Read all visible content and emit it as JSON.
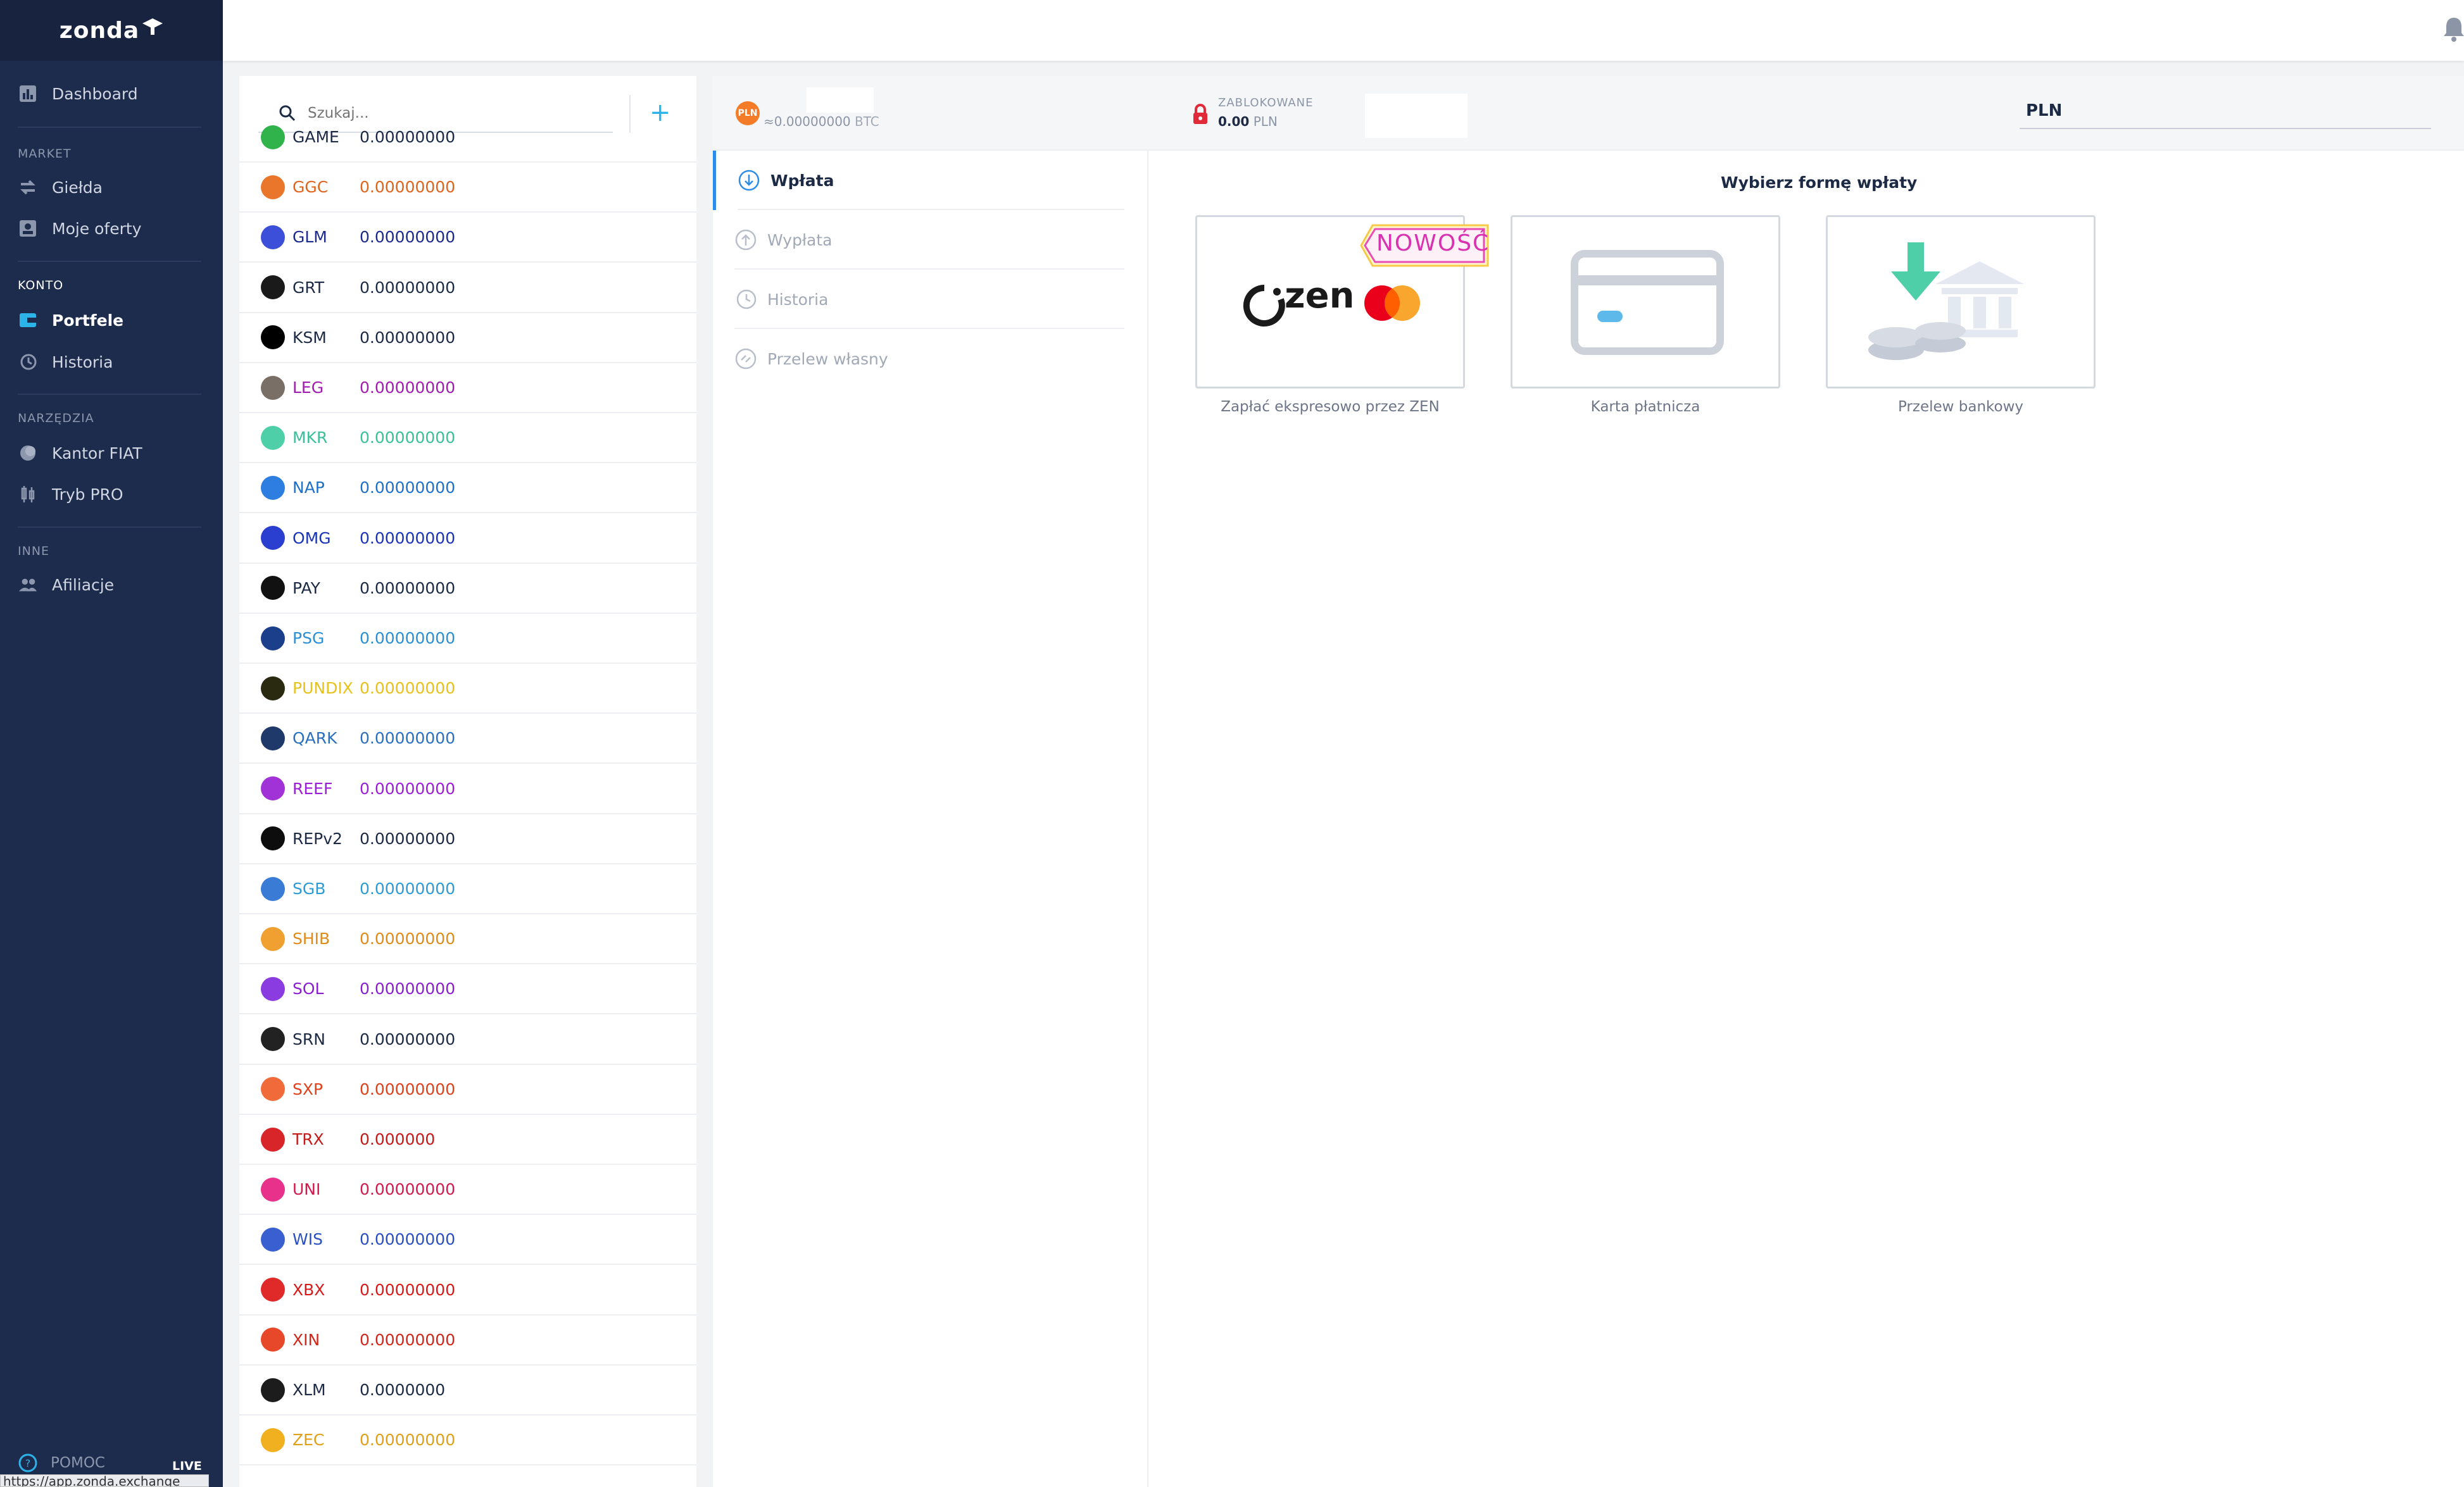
{
  "app": {
    "logo_text": "zonda"
  },
  "sidebar": {
    "dashboard": "Dashboard",
    "section_market": "MARKET",
    "gielda": "Giełda",
    "moje_oferty": "Moje oferty",
    "section_konto": "KONTO",
    "portfele": "Portfele",
    "historia": "Historia",
    "section_narzedzia": "NARZĘDZIA",
    "kantor": "Kantor FIAT",
    "tryb_pro": "Tryb PRO",
    "section_inne": "INNE",
    "afiliacje": "Afiliacje",
    "pomoc": "POMOC",
    "live": "LIVE",
    "status_url": "https://app.zonda.exchange"
  },
  "wallets": {
    "search_placeholder": "Szukaj...",
    "add": "+",
    "rows": [
      {
        "symbol": "GAME",
        "balance": "0.00000000",
        "color": "#1c2a45",
        "icon": "#2fb34a"
      },
      {
        "symbol": "GGC",
        "balance": "0.00000000",
        "color": "#e0641c",
        "icon": "#e9762a"
      },
      {
        "symbol": "GLM",
        "balance": "0.00000000",
        "color": "#1c2a8c",
        "icon": "#3c4fd8"
      },
      {
        "symbol": "GRT",
        "balance": "0.00000000",
        "color": "#1c2a45",
        "icon": "#1a1a1a"
      },
      {
        "symbol": "KSM",
        "balance": "0.00000000",
        "color": "#1c2a45",
        "icon": "#000000"
      },
      {
        "symbol": "LEG",
        "balance": "0.00000000",
        "color": "#a21caf",
        "icon": "#7a6f66"
      },
      {
        "symbol": "MKR",
        "balance": "0.00000000",
        "color": "#3bbf9a",
        "icon": "#4fcfa8"
      },
      {
        "symbol": "NAP",
        "balance": "0.00000000",
        "color": "#1f6fc9",
        "icon": "#2d7ee0"
      },
      {
        "symbol": "OMG",
        "balance": "0.00000000",
        "color": "#1a34b8",
        "icon": "#2a3fd0"
      },
      {
        "symbol": "PAY",
        "balance": "0.00000000",
        "color": "#1c2a45",
        "icon": "#111111"
      },
      {
        "symbol": "PSG",
        "balance": "0.00000000",
        "color": "#2b8fd6",
        "icon": "#1c3f8c"
      },
      {
        "symbol": "PUNDIX",
        "balance": "0.00000000",
        "color": "#e8c21a",
        "icon": "#2a2a10"
      },
      {
        "symbol": "QARK",
        "balance": "0.00000000",
        "color": "#2b6fbf",
        "icon": "#1f3a6a"
      },
      {
        "symbol": "REEF",
        "balance": "0.00000000",
        "color": "#9b1fd6",
        "icon": "#a032d8"
      },
      {
        "symbol": "REPv2",
        "balance": "0.00000000",
        "color": "#1c2a45",
        "icon": "#0d0d0d"
      },
      {
        "symbol": "SGB",
        "balance": "0.00000000",
        "color": "#2c9bd6",
        "icon": "#3a7bd6"
      },
      {
        "symbol": "SHIB",
        "balance": "0.00000000",
        "color": "#e08a1a",
        "icon": "#f0a030"
      },
      {
        "symbol": "SOL",
        "balance": "0.00000000",
        "color": "#8a1fd0",
        "icon": "#8a3ce0"
      },
      {
        "symbol": "SRN",
        "balance": "0.00000000",
        "color": "#1c2a45",
        "icon": "#222222"
      },
      {
        "symbol": "SXP",
        "balance": "0.00000000",
        "color": "#e0401a",
        "icon": "#f06a3a"
      },
      {
        "symbol": "TRX",
        "balance": "0.000000",
        "color": "#c41a1a",
        "icon": "#d8252a"
      },
      {
        "symbol": "UNI",
        "balance": "0.00000000",
        "color": "#d41a4c",
        "icon": "#e8318a"
      },
      {
        "symbol": "WIS",
        "balance": "0.00000000",
        "color": "#2a4fc0",
        "icon": "#3a5fd0"
      },
      {
        "symbol": "XBX",
        "balance": "0.00000000",
        "color": "#d81a1a",
        "icon": "#e02a2a"
      },
      {
        "symbol": "XIN",
        "balance": "0.00000000",
        "color": "#d4261a",
        "icon": "#e8482a"
      },
      {
        "symbol": "XLM",
        "balance": "0.0000000",
        "color": "#1c2a45",
        "icon": "#1c1c1c"
      },
      {
        "symbol": "ZEC",
        "balance": "0.00000000",
        "color": "#e0a01a",
        "icon": "#f0b020"
      }
    ]
  },
  "balance": {
    "currency_badge": "PLN",
    "btc_value": "≈0.00000000",
    "btc_unit": "BTC",
    "locked_label": "ZABLOKOWANE",
    "locked_value": "0.00",
    "locked_unit": "PLN",
    "currency_select": "PLN"
  },
  "tabs": {
    "wplata": "Wpłata",
    "wyplata": "Wypłata",
    "historia": "Historia",
    "przelew": "Przelew własny"
  },
  "deposit": {
    "title": "Wybierz formę wpłaty",
    "new_badge": "NOWOŚĆ",
    "zen_logo": "zen",
    "zen_label": "Zapłać ekspresowo przez ZEN",
    "card_label": "Karta płatnicza",
    "bank_label": "Przelew bankowy"
  }
}
